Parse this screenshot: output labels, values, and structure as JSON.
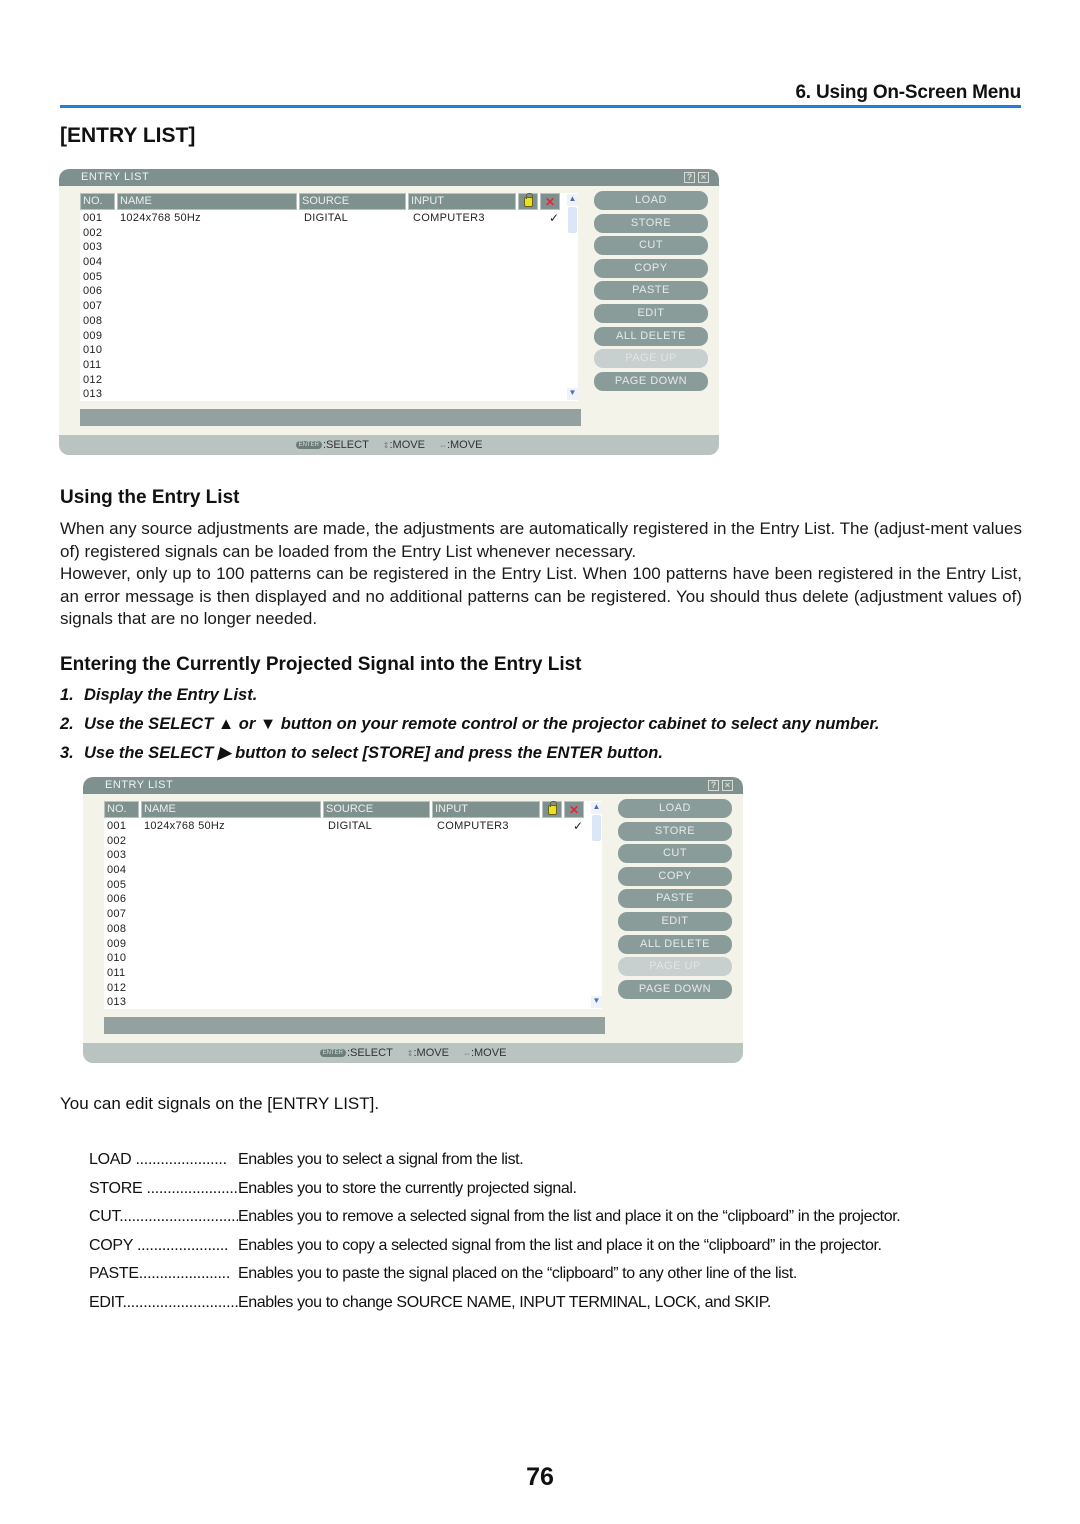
{
  "header": {
    "running_title": "6. Using On-Screen Menu",
    "section_title": "[ENTRY LIST]"
  },
  "osd": {
    "title": "ENTRY LIST",
    "help_icon": "question-icon",
    "close_icon": "close-icon",
    "columns": {
      "no": "NO.",
      "name": "NAME",
      "source": "SOURCE",
      "input": "INPUT",
      "lock_icon": "lock-icon",
      "skip_icon": "skip-icon"
    },
    "rows": [
      {
        "no": "001",
        "name": "1024x768 50Hz",
        "source": "DIGITAL",
        "input": "COMPUTER3",
        "check": "✓"
      },
      {
        "no": "002",
        "name": "",
        "source": "",
        "input": "",
        "check": ""
      },
      {
        "no": "003",
        "name": "",
        "source": "",
        "input": "",
        "check": ""
      },
      {
        "no": "004",
        "name": "",
        "source": "",
        "input": "",
        "check": ""
      },
      {
        "no": "005",
        "name": "",
        "source": "",
        "input": "",
        "check": ""
      },
      {
        "no": "006",
        "name": "",
        "source": "",
        "input": "",
        "check": ""
      },
      {
        "no": "007",
        "name": "",
        "source": "",
        "input": "",
        "check": ""
      },
      {
        "no": "008",
        "name": "",
        "source": "",
        "input": "",
        "check": ""
      },
      {
        "no": "009",
        "name": "",
        "source": "",
        "input": "",
        "check": ""
      },
      {
        "no": "010",
        "name": "",
        "source": "",
        "input": "",
        "check": ""
      },
      {
        "no": "011",
        "name": "",
        "source": "",
        "input": "",
        "check": ""
      },
      {
        "no": "012",
        "name": "",
        "source": "",
        "input": "",
        "check": ""
      },
      {
        "no": "013",
        "name": "",
        "source": "",
        "input": "",
        "check": ""
      }
    ],
    "buttons": [
      {
        "label": "LOAD",
        "enabled": true
      },
      {
        "label": "STORE",
        "enabled": true
      },
      {
        "label": "CUT",
        "enabled": true
      },
      {
        "label": "COPY",
        "enabled": true
      },
      {
        "label": "PASTE",
        "enabled": true
      },
      {
        "label": "EDIT",
        "enabled": true
      },
      {
        "label": "ALL DELETE",
        "enabled": true
      },
      {
        "label": "PAGE UP",
        "enabled": false
      },
      {
        "label": "PAGE DOWN",
        "enabled": true
      }
    ],
    "footer": {
      "enter_key": "ENTER",
      "select": ":SELECT",
      "move_ud": ":MOVE",
      "move_lr": ":MOVE"
    }
  },
  "using": {
    "heading": "Using the Entry List",
    "para1": "When any source adjustments are made, the adjustments are automatically registered in the Entry List. The (adjust-ment values of) registered signals can be loaded from the Entry List whenever necessary.",
    "para2": "However, only up to 100 patterns can be registered in the Entry List. When 100 patterns have been registered in the Entry List, an error message is then displayed and no additional patterns can be registered. You should thus delete (adjustment values of) signals that are no longer needed."
  },
  "entering": {
    "heading": "Entering the Currently Projected Signal into the Entry List",
    "steps": [
      {
        "num": "1.",
        "text": "Display the Entry List."
      },
      {
        "num": "2.",
        "text": "Use the SELECT ▲ or ▼ button on your remote control or the projector cabinet to select any number."
      },
      {
        "num": "3.",
        "text": "Use the SELECT ▶ button to select [STORE] and press the ENTER button."
      }
    ]
  },
  "edit_intro": "You can edit signals on the [ENTRY LIST].",
  "definitions": [
    {
      "term": "LOAD ......................",
      "desc": "Enables you to select a signal from the list."
    },
    {
      "term": "STORE ......................",
      "desc": "Enables you to store the currently projected signal."
    },
    {
      "term": "CUT..............................",
      "desc": "Enables you to remove a selected signal from the list and place it on the “clipboard” in the projector."
    },
    {
      "term": "COPY ......................",
      "desc": "Enables you to copy a selected signal from the list and place it on the “clipboard” in the projector."
    },
    {
      "term": "PASTE......................",
      "desc": "Enables you to paste the signal placed on the “clipboard” to any other line of the list."
    },
    {
      "term": "EDIT..............................",
      "desc": "Enables you to change SOURCE NAME, INPUT TERMINAL, LOCK, and SKIP."
    }
  ],
  "page_number": "76"
}
